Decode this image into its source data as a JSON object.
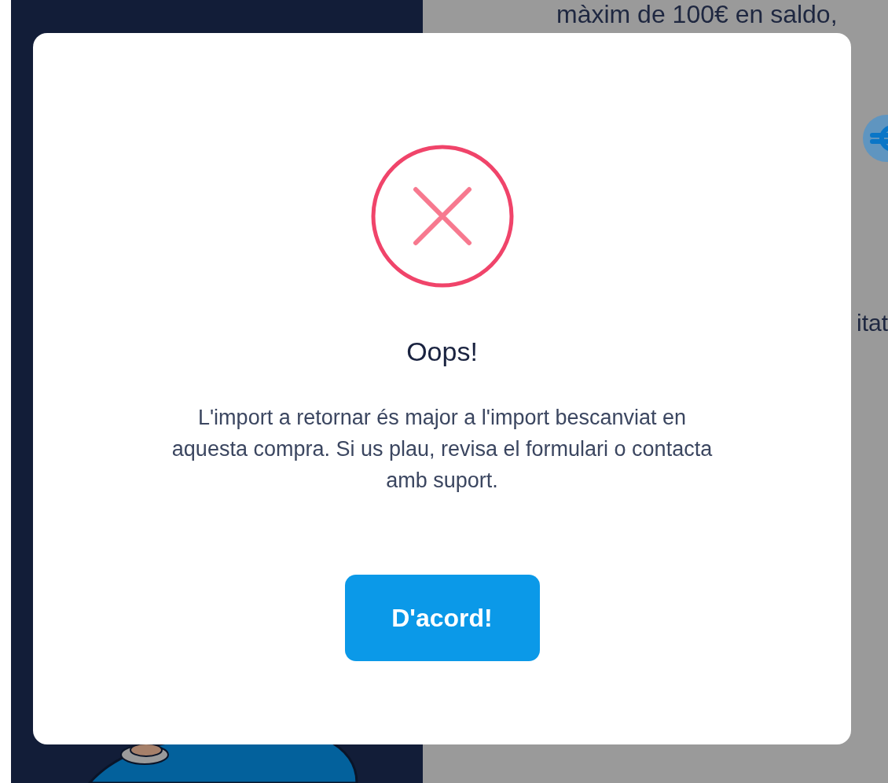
{
  "background": {
    "top_text": "màxim de 100€ en saldo,",
    "side_text": "itat"
  },
  "dialog": {
    "title": "Oops!",
    "message": "L'import a retornar és major a l'import bescanviat en aquesta compra. Si us plau, revisa el formulari o contacta amb suport.",
    "button": "D'acord!"
  }
}
